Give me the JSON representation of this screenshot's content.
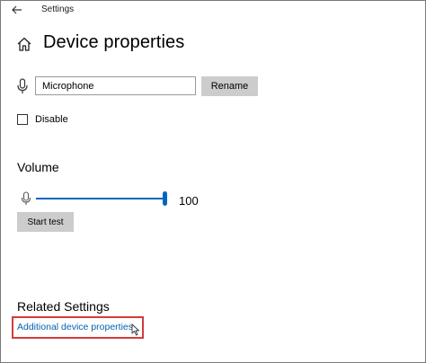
{
  "window": {
    "title": "Settings",
    "back_icon": "back-arrow-icon"
  },
  "page": {
    "title": "Device properties",
    "home_icon": "home-icon"
  },
  "device": {
    "icon": "microphone-icon",
    "name_value": "Microphone",
    "rename_label": "Rename"
  },
  "disable": {
    "label": "Disable",
    "checked": false
  },
  "volume": {
    "heading": "Volume",
    "icon": "microphone-icon",
    "value": "100",
    "level_percent": 100,
    "accent_color": "#0067c0",
    "start_test_label": "Start test"
  },
  "related": {
    "heading": "Related Settings",
    "link_label": "Additional device properties",
    "link_color": "#0063b1",
    "highlight_color": "#d23c3c"
  }
}
